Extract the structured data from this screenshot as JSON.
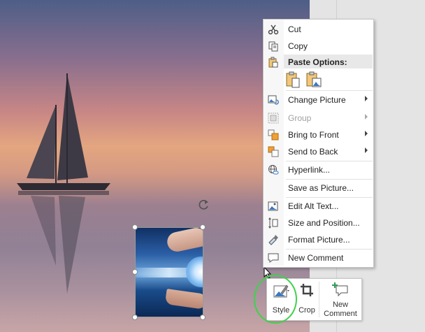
{
  "context_menu": {
    "items": [
      {
        "label": "Cut",
        "icon": "scissors-icon",
        "disabled": false,
        "submenu": false
      },
      {
        "label": "Copy",
        "icon": "copy-icon",
        "disabled": false,
        "submenu": false
      },
      {
        "label": "Change Picture",
        "icon": "change-picture-icon",
        "disabled": false,
        "submenu": true
      },
      {
        "label": "Group",
        "icon": "group-icon",
        "disabled": true,
        "submenu": true
      },
      {
        "label": "Bring to Front",
        "icon": "bring-to-front-icon",
        "disabled": false,
        "submenu": true
      },
      {
        "label": "Send to Back",
        "icon": "send-to-back-icon",
        "disabled": false,
        "submenu": true
      },
      {
        "label": "Hyperlink...",
        "icon": "hyperlink-icon",
        "disabled": false,
        "submenu": false
      },
      {
        "label": "Save as Picture...",
        "icon": "",
        "disabled": false,
        "submenu": false
      },
      {
        "label": "Edit Alt Text...",
        "icon": "alt-text-icon",
        "disabled": false,
        "submenu": false
      },
      {
        "label": "Size and Position...",
        "icon": "size-position-icon",
        "disabled": false,
        "submenu": false
      },
      {
        "label": "Format Picture...",
        "icon": "format-picture-icon",
        "disabled": false,
        "submenu": false
      },
      {
        "label": "New Comment",
        "icon": "comment-icon",
        "disabled": false,
        "submenu": false
      }
    ],
    "paste_options_label": "Paste Options:"
  },
  "mini_toolbar": {
    "style_label": "Style",
    "crop_label": "Crop",
    "new_comment_label_line1": "New",
    "new_comment_label_line2": "Comment"
  },
  "colors": {
    "highlight_ring": "#3fd24c",
    "menu_border": "#c6c6c6"
  }
}
